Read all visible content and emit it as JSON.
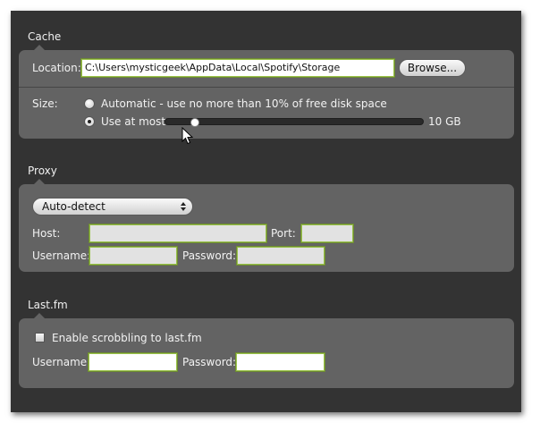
{
  "cache": {
    "title": "Cache",
    "location_label": "Location:",
    "location_value": "C:\\Users\\mysticgeek\\AppData\\Local\\Spotify\\Storage",
    "browse_label": "Browse...",
    "size_label": "Size:",
    "option_automatic": "Automatic - use no more than 10% of free disk space",
    "option_use_at_most": "Use at most",
    "selected_option": "Use at most",
    "slider_fraction": 0.1,
    "size_value": "10 GB"
  },
  "proxy": {
    "title": "Proxy",
    "mode_selected": "Auto-detect",
    "host_label": "Host:",
    "port_label": "Port:",
    "username_label": "Username:",
    "password_label": "Password:",
    "host_value": "",
    "port_value": "",
    "username_value": "",
    "password_value": ""
  },
  "lastfm": {
    "title": "Last.fm",
    "scrobble_label": "Enable scrobbling to last.fm",
    "scrobble_checked": false,
    "username_label": "Username:",
    "password_label": "Password:",
    "username_value": "",
    "password_value": ""
  },
  "colors": {
    "window_bg": "#333333",
    "panel_bg": "#636363",
    "field_focus_border": "#9bc34a"
  },
  "icons": {
    "mouse_cursor": "arrow-cursor-icon",
    "select_arrows": "up-down-arrows-icon"
  }
}
